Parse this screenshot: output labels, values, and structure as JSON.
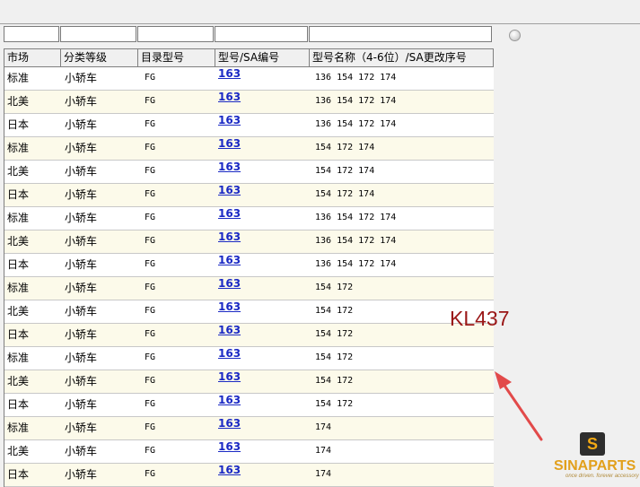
{
  "table": {
    "columns": [
      "市场",
      "分类等级",
      "目录型号",
      "型号/SA编号",
      "型号名称（4-6位）/SA更改序号"
    ],
    "rows": [
      [
        "标准",
        "小轿车",
        "FG",
        "163",
        "136 154 172 174"
      ],
      [
        "北美",
        "小轿车",
        "FG",
        "163",
        "136 154 172 174"
      ],
      [
        "日本",
        "小轿车",
        "FG",
        "163",
        "136 154 172 174"
      ],
      [
        "标准",
        "小轿车",
        "FG",
        "163",
        "154 172 174"
      ],
      [
        "北美",
        "小轿车",
        "FG",
        "163",
        "154 172 174"
      ],
      [
        "日本",
        "小轿车",
        "FG",
        "163",
        "154 172 174"
      ],
      [
        "标准",
        "小轿车",
        "FG",
        "163",
        "136 154 172 174"
      ],
      [
        "北美",
        "小轿车",
        "FG",
        "163",
        "136 154 172 174"
      ],
      [
        "日本",
        "小轿车",
        "FG",
        "163",
        "136 154 172 174"
      ],
      [
        "标准",
        "小轿车",
        "FG",
        "163",
        "154 172"
      ],
      [
        "北美",
        "小轿车",
        "FG",
        "163",
        "154 172"
      ],
      [
        "日本",
        "小轿车",
        "FG",
        "163",
        "154 172"
      ],
      [
        "标准",
        "小轿车",
        "FG",
        "163",
        "154 172"
      ],
      [
        "北美",
        "小轿车",
        "FG",
        "163",
        "154 172"
      ],
      [
        "日本",
        "小轿车",
        "FG",
        "163",
        "154 172"
      ],
      [
        "标准",
        "小轿车",
        "FG",
        "163",
        "174"
      ],
      [
        "北美",
        "小轿车",
        "FG",
        "163",
        "174"
      ],
      [
        "日本",
        "小轿车",
        "FG",
        "163",
        "174"
      ]
    ]
  },
  "filters": {
    "values": [
      "",
      "",
      "",
      "",
      ""
    ]
  },
  "watermark": {
    "label": "KL437",
    "logo_letter": "S",
    "logo_text": "SINAPARTS",
    "logo_tagline": "once driven. forever accessory"
  },
  "colors": {
    "link": "#1a29c4",
    "alt_row": "#fcfaea",
    "watermark": "#9a1616",
    "arrow": "#e24a4a",
    "logo": "#e2a01c"
  }
}
